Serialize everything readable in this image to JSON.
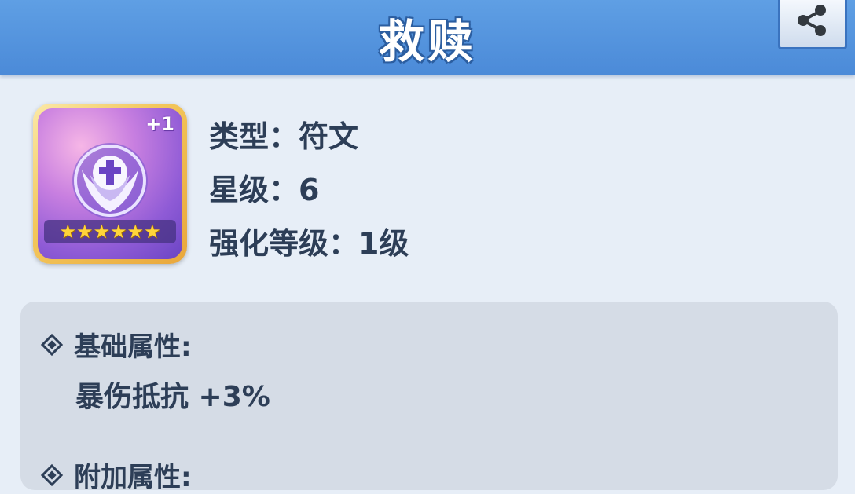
{
  "header": {
    "title": "救赎",
    "share_icon": "share-icon"
  },
  "item": {
    "icon": "rune-cross-wings-icon",
    "badge": "+1",
    "star_count": 6,
    "stars": [
      "★",
      "★",
      "★",
      "★",
      "★",
      "★"
    ],
    "type_line": "类型：符文",
    "star_line": "星级：6",
    "enhance_line": "强化等级：1级"
  },
  "attributes": {
    "base_heading": "基础属性:",
    "base_stat": "暴伤抵抗 +3%",
    "extra_heading": "附加属性:"
  },
  "colors": {
    "header_blue": "#4b8ad8",
    "text_dark": "#2d3e57",
    "panel_bg": "#d5dce6",
    "star_gold": "#ffd43a"
  }
}
